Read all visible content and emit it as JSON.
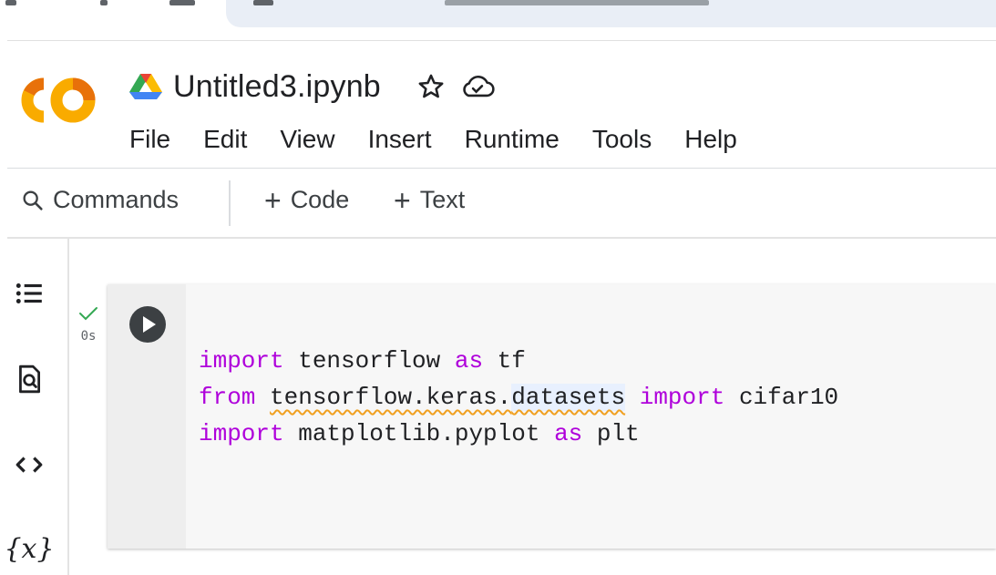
{
  "notebook": {
    "title": "Untitled3.ipynb",
    "logo_text": "CO"
  },
  "menu": [
    "File",
    "Edit",
    "View",
    "Insert",
    "Runtime",
    "Tools",
    "Help"
  ],
  "toolbar": {
    "commands_label": "Commands",
    "add_code_label": "Code",
    "add_text_label": "Text"
  },
  "sidebar": {
    "icons": [
      "table-of-contents-icon",
      "find-replace-icon",
      "code-snippets-icon",
      "variables-icon"
    ],
    "variables_glyph": "{x}"
  },
  "cell": {
    "exec_time": "0s",
    "lines": [
      [
        {
          "t": "import",
          "k": "kw"
        },
        {
          "t": " tensorflow "
        },
        {
          "t": "as",
          "k": "kw"
        },
        {
          "t": " tf"
        }
      ],
      [
        {
          "t": "from",
          "k": "kw"
        },
        {
          "t": " "
        },
        {
          "t": "tensorflow.keras.",
          "k": "squiggle"
        },
        {
          "t": "datasets",
          "k": "squiggle hl"
        },
        {
          "t": " "
        },
        {
          "t": "import",
          "k": "kw"
        },
        {
          "t": " cifar10"
        }
      ],
      [
        {
          "t": "import",
          "k": "kw"
        },
        {
          "t": " matplotlib.pyplot "
        },
        {
          "t": "as",
          "k": "kw"
        },
        {
          "t": " plt"
        }
      ]
    ]
  },
  "colors": {
    "keyword": "#af00db",
    "logo_orange": "#f9ab00",
    "logo_dark_orange": "#e8710a",
    "check_green": "#34a853"
  }
}
